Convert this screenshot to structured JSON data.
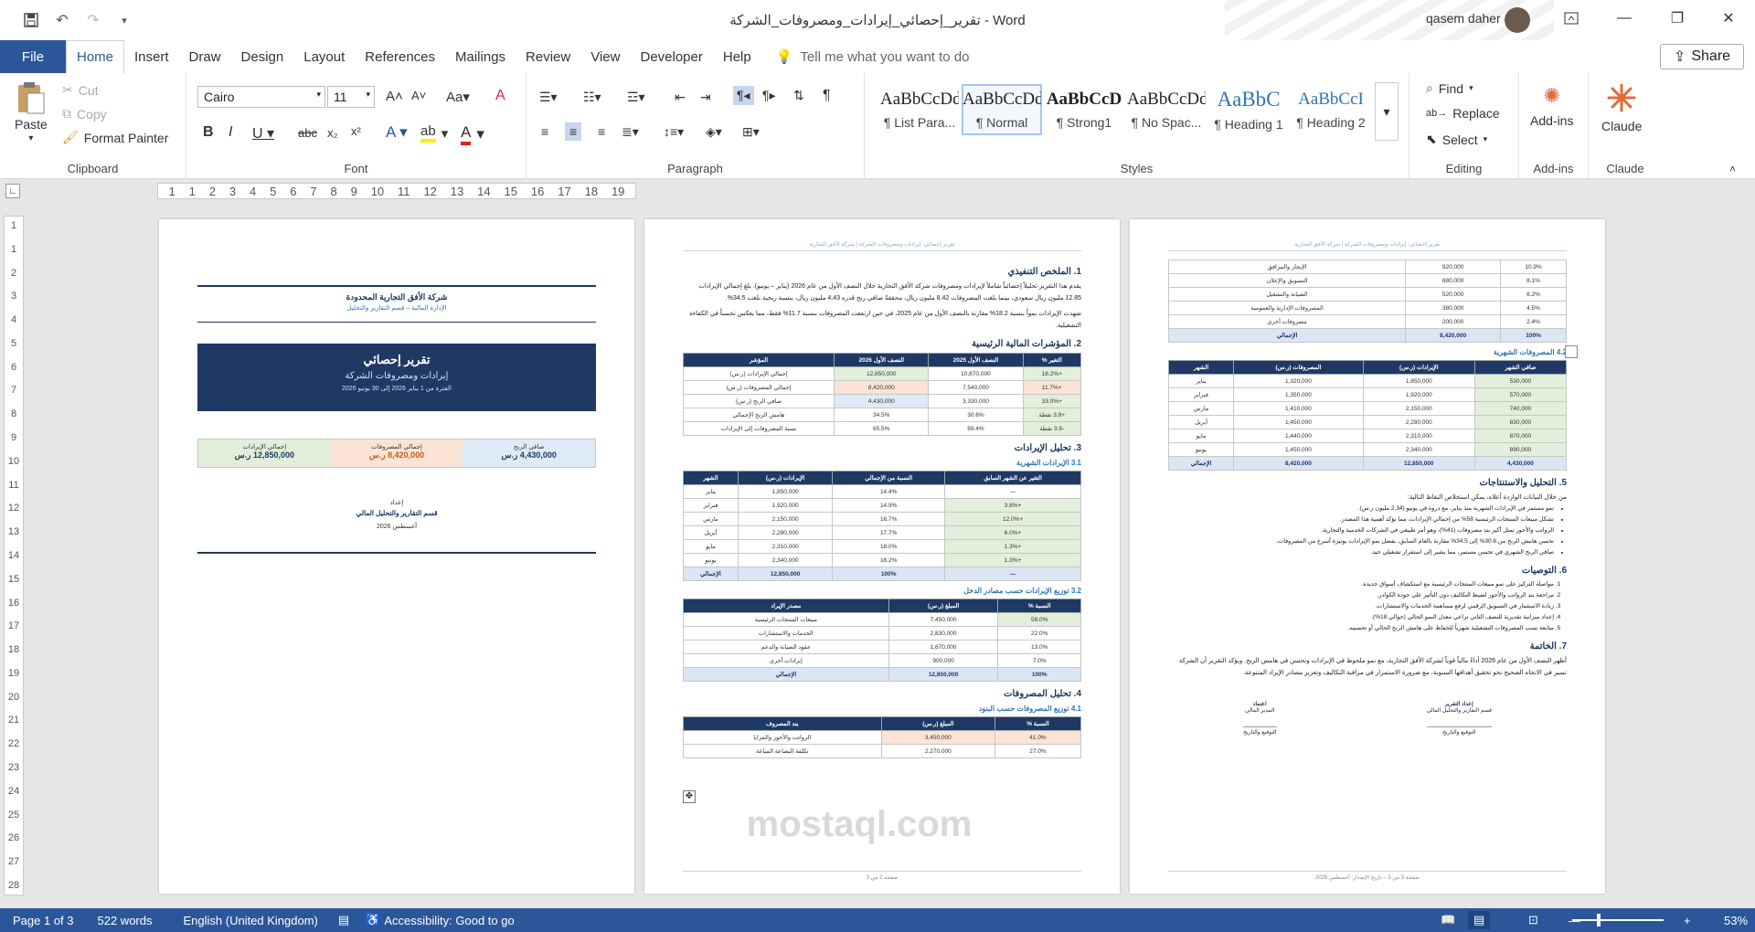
{
  "window": {
    "title": "تقرير_إحصائي_إيرادات_ومصروفات_الشركة  -  Word",
    "user": "qasem daher"
  },
  "tabs": [
    "File",
    "Home",
    "Insert",
    "Draw",
    "Design",
    "Layout",
    "References",
    "Mailings",
    "Review",
    "View",
    "Developer",
    "Help"
  ],
  "tellme": "Tell me what you want to do",
  "share": "Share",
  "clipboard": {
    "paste": "Paste",
    "cut": "Cut",
    "copy": "Copy",
    "format_painter": "Format Painter",
    "label": "Clipboard"
  },
  "font": {
    "name": "Cairo",
    "size": "11",
    "label": "Font"
  },
  "paragraph": {
    "label": "Paragraph"
  },
  "styles": {
    "label": "Styles",
    "items": [
      {
        "preview": "AaBbCcDd",
        "name": "¶ List Para..."
      },
      {
        "preview": "AaBbCcDd",
        "name": "¶ Normal"
      },
      {
        "preview": "AaBbCcD",
        "name": "¶ Strong1"
      },
      {
        "preview": "AaBbCcDd",
        "name": "¶ No Spac..."
      },
      {
        "preview": "AaBbC",
        "name": "¶ Heading 1"
      },
      {
        "preview": "AaBbCcI",
        "name": "¶ Heading 2"
      }
    ]
  },
  "editing": {
    "find": "Find",
    "replace": "Replace",
    "select": "Select",
    "label": "Editing"
  },
  "addins": {
    "button": "Add-ins",
    "label": "Add-ins"
  },
  "claude": {
    "button": "Claude",
    "label": "Claude"
  },
  "ruler_marks": [
    "1",
    "1",
    "2",
    "3",
    "4",
    "5",
    "6",
    "7",
    "8",
    "9",
    "10",
    "11",
    "12",
    "13",
    "14",
    "15",
    "16",
    "17",
    "18",
    "19"
  ],
  "vruler_marks": [
    "1",
    "1",
    "2",
    "3",
    "4",
    "5",
    "6",
    "7",
    "8",
    "9",
    "10",
    "11",
    "12",
    "13",
    "14",
    "15",
    "16",
    "17",
    "18",
    "19",
    "20",
    "21",
    "22",
    "23",
    "24",
    "25",
    "26",
    "27",
    "28"
  ],
  "page1": {
    "company": "شركة الأفق التجارية المحدودة",
    "dept": "الإدارة المالية – قسم التقارير والتحليل",
    "title": "تقرير إحصائي",
    "subtitle": "إيرادات ومصروفات الشركة",
    "period": "الفترة من 1 يناير 2026 إلى 30 يونيو 2026",
    "kpis": [
      {
        "label": "صافي الربح",
        "value": "4,430,000 ر.س"
      },
      {
        "label": "إجمالي المصروفات",
        "value": "8,420,000 ر.س"
      },
      {
        "label": "إجمالي الإيرادات",
        "value": "12,850,000 ر.س"
      }
    ],
    "prepared_by": "إعداد",
    "prepared_dept": "قسم التقارير والتحليل المالي",
    "date": "أغسطس 2026"
  },
  "page2": {
    "header": "تقرير إحصائي: إيرادات ومصروفات الشركة | شركة الأفق التجارية",
    "s1": "1. الملخص التنفيذي",
    "p1": "يقدم هذا التقرير تحليلاً إحصائياً شاملاً لإيرادات ومصروفات شركة الأفق التجارية خلال النصف الأول من عام 2026 (يناير – يونيو). بلغ إجمالي الإيرادات 12.85 مليون ريال سعودي، بينما بلغت المصروفات 8.42 مليون ريال، محققةً صافي ربح قدره 4.43 مليون ريال، بنسبة ربحية بلغت 34.5%.",
    "p2": "شهدت الإيرادات نمواً بنسبة 18.2% مقارنة بالنصف الأول من عام 2025، في حين ارتفعت المصروفات بنسبة 11.7% فقط، مما يعكس تحسناً في الكفاءة التشغيلية.",
    "s2": "2. المؤشرات المالية الرئيسية",
    "t1_head": [
      "التغير %",
      "النصف الأول 2025",
      "النصف الأول 2026",
      "المؤشر"
    ],
    "t1_rows": [
      [
        "+18.2%",
        "10,870,000",
        "12,850,000",
        "إجمالي الإيرادات (ر.س)"
      ],
      [
        "+11.7%",
        "7,540,000",
        "8,420,000",
        "إجمالي المصروفات (ر.س)"
      ],
      [
        "+33.0%",
        "3,330,000",
        "4,430,000",
        "صافي الربح (ر.س)"
      ],
      [
        "+3.9 نقطة",
        "30.6%",
        "34.5%",
        "هامش الربح الإجمالي"
      ],
      [
        "-3.9 نقطة",
        "69.4%",
        "65.5%",
        "نسبة المصروفات إلى الإيرادات"
      ]
    ],
    "s3": "3. تحليل الإيرادات",
    "s31": "3.1 الإيرادات الشهرية",
    "t2_head": [
      "التغير عن الشهر السابق",
      "النسبة من الإجمالي",
      "الإيرادات (ر.س)",
      "الشهر"
    ],
    "t2_rows": [
      [
        "—",
        "14.4%",
        "1,850,000",
        "يناير"
      ],
      [
        "+3.8%",
        "14.9%",
        "1,920,000",
        "فبراير"
      ],
      [
        "+12.0%",
        "16.7%",
        "2,150,000",
        "مارس"
      ],
      [
        "+6.0%",
        "17.7%",
        "2,280,000",
        "أبريل"
      ],
      [
        "+1.3%",
        "18.0%",
        "2,310,000",
        "مايو"
      ],
      [
        "+1.3%",
        "18.2%",
        "2,340,000",
        "يونيو"
      ]
    ],
    "t2_total": [
      "—",
      "100%",
      "12,850,000",
      "الإجمالي"
    ],
    "s32": "3.2 توزيع الإيرادات حسب مصادر الدخل",
    "t3_head": [
      "النسبة %",
      "المبلغ (ر.س)",
      "مصدر الإيراد"
    ],
    "t3_rows": [
      [
        "58.0%",
        "7,450,000",
        "مبيعات المنتجات الرئيسية"
      ],
      [
        "22.0%",
        "2,830,000",
        "الخدمات والاستشارات"
      ],
      [
        "13.0%",
        "1,670,000",
        "عقود الصيانة والدعم"
      ],
      [
        "7.0%",
        "900,000",
        "إيرادات أخرى"
      ]
    ],
    "t3_total": [
      "100%",
      "12,850,000",
      "الإجمالي"
    ],
    "s4": "4. تحليل المصروفات",
    "s41": "4.1 توزيع المصروفات حسب البنود",
    "t4_head": [
      "النسبة %",
      "المبلغ (ر.س)",
      "بند المصروف"
    ],
    "t4_rows": [
      [
        "41.0%",
        "3,450,000",
        "الرواتب والأجور والمزايا"
      ],
      [
        "27.0%",
        "2,270,000",
        "تكلفة البضاعة المباعة"
      ]
    ],
    "footer": "صفحة 2 من 3"
  },
  "page3": {
    "header": "تقرير إحصائي: إيرادات ومصروفات الشركة | شركة الأفق التجارية",
    "t5_rows": [
      [
        "10.9%",
        "920,000",
        "الإيجار والمرافق"
      ],
      [
        "8.1%",
        "680,000",
        "التسويق والإعلان"
      ],
      [
        "6.2%",
        "520,000",
        "الصيانة والتشغيل"
      ],
      [
        "4.5%",
        "380,000",
        "المصروفات الإدارية والعمومية"
      ],
      [
        "2.4%",
        "200,000",
        "مصروفات أخرى"
      ]
    ],
    "t5_total": [
      "100%",
      "8,420,000",
      "الإجمالي"
    ],
    "s42": "4.2 المصروفات الشهرية",
    "t6_head": [
      "صافي الشهر",
      "الإيرادات (ر.س)",
      "المصروفات (ر.س)",
      "الشهر"
    ],
    "t6_rows": [
      [
        "530,000",
        "1,850,000",
        "1,320,000",
        "يناير"
      ],
      [
        "570,000",
        "1,920,000",
        "1,350,000",
        "فبراير"
      ],
      [
        "740,000",
        "2,150,000",
        "1,410,000",
        "مارس"
      ],
      [
        "830,000",
        "2,280,000",
        "1,450,000",
        "أبريل"
      ],
      [
        "870,000",
        "2,310,000",
        "1,440,000",
        "مايو"
      ],
      [
        "890,000",
        "2,340,000",
        "1,450,000",
        "يونيو"
      ]
    ],
    "t6_total": [
      "4,430,000",
      "12,850,000",
      "8,420,000",
      "الإجمالي"
    ],
    "s5": "5. التحليل والاستنتاجات",
    "p5": "من خلال البيانات الواردة أعلاه، يمكن استخلاص النقاط التالية:",
    "bullets": [
      "نمو مستمر في الإيرادات الشهرية منذ يناير، مع ذروة في يونيو (2.34 مليون ر.س).",
      "تشكل مبيعات المنتجات الرئيسية 58% من إجمالي الإيرادات، مما يؤكد أهمية هذا المصدر.",
      "الرواتب والأجور تمثل أكبر بند مصروفات (41%)، وهو أمر طبيعي في الشركات الخدمية والتجارية.",
      "تحسن هامش الربح من 30.6% إلى 34.5% مقارنة بالعام السابق، بفضل نمو الإيرادات بوتيرة أسرع من المصروفات.",
      "صافي الربح الشهري في تحسن مستمر، مما يشير إلى استقرار تشغيلي جيد."
    ],
    "s6": "6. التوصيات",
    "recs": [
      "مواصلة التركيز على نمو مبيعات المنتجات الرئيسية مع استكشاف أسواق جديدة.",
      "مراجعة بند الرواتب والأجور لضبط التكاليف دون التأثير على جودة الكوادر.",
      "زيادة الاستثمار في التسويق الرقمي لرفع مساهمة الخدمات والاستشارات.",
      "إعداد ميزانية تقديرية للنصف الثاني تراعي معدل النمو الحالي (حوالي 18%).",
      "متابعة نسب المصروفات التشغيلية شهرياً للحفاظ على هامش الربح الحالي أو تحسينه."
    ],
    "s7": "7. الخاتمة",
    "p7": "أظهر النصف الأول من عام 2026 أداءً مالياً قوياً لشركة الأفق التجارية، مع نمو ملحوظ في الإيرادات وتحسن في هامش الربح. ويؤكد التقرير أن الشركة تسير في الاتجاه الصحيح نحو تحقيق أهدافها السنوية، مع ضرورة الاستمرار في مراقبة التكاليف وتعزيز مصادر الإيراد المتنوعة.",
    "sig1_title": "إعداد التقرير",
    "sig1_name": "قسم التقارير والتحليل المالي",
    "sig1_sign": "التوقيع والتاريخ",
    "sig2_title": "اعتماد",
    "sig2_name": "المدير المالي",
    "sig2_sign": "التوقيع والتاريخ",
    "footer": "صفحة 3 من 3 – تاريخ الإصدار: أغسطس 2026"
  },
  "status": {
    "page": "Page 1 of 3",
    "words": "522 words",
    "lang": "English (United Kingdom)",
    "access": "Accessibility: Good to go",
    "zoom": "53%"
  },
  "watermark": "mostaql.com",
  "colors": {
    "word_blue": "#2b579a",
    "navy": "#1f3864",
    "accent": "#2e75b6",
    "claude": "#e0693a"
  }
}
